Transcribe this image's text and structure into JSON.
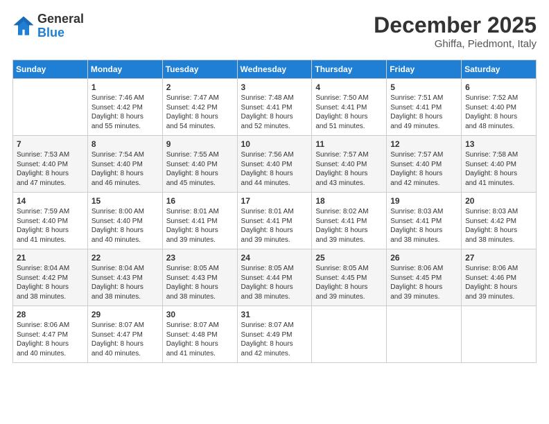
{
  "header": {
    "logo_general": "General",
    "logo_blue": "Blue",
    "month_title": "December 2025",
    "subtitle": "Ghiffa, Piedmont, Italy"
  },
  "weekdays": [
    "Sunday",
    "Monday",
    "Tuesday",
    "Wednesday",
    "Thursday",
    "Friday",
    "Saturday"
  ],
  "weeks": [
    [
      {
        "day": "",
        "text": ""
      },
      {
        "day": "1",
        "text": "Sunrise: 7:46 AM\nSunset: 4:42 PM\nDaylight: 8 hours\nand 55 minutes."
      },
      {
        "day": "2",
        "text": "Sunrise: 7:47 AM\nSunset: 4:42 PM\nDaylight: 8 hours\nand 54 minutes."
      },
      {
        "day": "3",
        "text": "Sunrise: 7:48 AM\nSunset: 4:41 PM\nDaylight: 8 hours\nand 52 minutes."
      },
      {
        "day": "4",
        "text": "Sunrise: 7:50 AM\nSunset: 4:41 PM\nDaylight: 8 hours\nand 51 minutes."
      },
      {
        "day": "5",
        "text": "Sunrise: 7:51 AM\nSunset: 4:41 PM\nDaylight: 8 hours\nand 49 minutes."
      },
      {
        "day": "6",
        "text": "Sunrise: 7:52 AM\nSunset: 4:40 PM\nDaylight: 8 hours\nand 48 minutes."
      }
    ],
    [
      {
        "day": "7",
        "text": "Sunrise: 7:53 AM\nSunset: 4:40 PM\nDaylight: 8 hours\nand 47 minutes."
      },
      {
        "day": "8",
        "text": "Sunrise: 7:54 AM\nSunset: 4:40 PM\nDaylight: 8 hours\nand 46 minutes."
      },
      {
        "day": "9",
        "text": "Sunrise: 7:55 AM\nSunset: 4:40 PM\nDaylight: 8 hours\nand 45 minutes."
      },
      {
        "day": "10",
        "text": "Sunrise: 7:56 AM\nSunset: 4:40 PM\nDaylight: 8 hours\nand 44 minutes."
      },
      {
        "day": "11",
        "text": "Sunrise: 7:57 AM\nSunset: 4:40 PM\nDaylight: 8 hours\nand 43 minutes."
      },
      {
        "day": "12",
        "text": "Sunrise: 7:57 AM\nSunset: 4:40 PM\nDaylight: 8 hours\nand 42 minutes."
      },
      {
        "day": "13",
        "text": "Sunrise: 7:58 AM\nSunset: 4:40 PM\nDaylight: 8 hours\nand 41 minutes."
      }
    ],
    [
      {
        "day": "14",
        "text": "Sunrise: 7:59 AM\nSunset: 4:40 PM\nDaylight: 8 hours\nand 41 minutes."
      },
      {
        "day": "15",
        "text": "Sunrise: 8:00 AM\nSunset: 4:40 PM\nDaylight: 8 hours\nand 40 minutes."
      },
      {
        "day": "16",
        "text": "Sunrise: 8:01 AM\nSunset: 4:41 PM\nDaylight: 8 hours\nand 39 minutes."
      },
      {
        "day": "17",
        "text": "Sunrise: 8:01 AM\nSunset: 4:41 PM\nDaylight: 8 hours\nand 39 minutes."
      },
      {
        "day": "18",
        "text": "Sunrise: 8:02 AM\nSunset: 4:41 PM\nDaylight: 8 hours\nand 39 minutes."
      },
      {
        "day": "19",
        "text": "Sunrise: 8:03 AM\nSunset: 4:41 PM\nDaylight: 8 hours\nand 38 minutes."
      },
      {
        "day": "20",
        "text": "Sunrise: 8:03 AM\nSunset: 4:42 PM\nDaylight: 8 hours\nand 38 minutes."
      }
    ],
    [
      {
        "day": "21",
        "text": "Sunrise: 8:04 AM\nSunset: 4:42 PM\nDaylight: 8 hours\nand 38 minutes."
      },
      {
        "day": "22",
        "text": "Sunrise: 8:04 AM\nSunset: 4:43 PM\nDaylight: 8 hours\nand 38 minutes."
      },
      {
        "day": "23",
        "text": "Sunrise: 8:05 AM\nSunset: 4:43 PM\nDaylight: 8 hours\nand 38 minutes."
      },
      {
        "day": "24",
        "text": "Sunrise: 8:05 AM\nSunset: 4:44 PM\nDaylight: 8 hours\nand 38 minutes."
      },
      {
        "day": "25",
        "text": "Sunrise: 8:05 AM\nSunset: 4:45 PM\nDaylight: 8 hours\nand 39 minutes."
      },
      {
        "day": "26",
        "text": "Sunrise: 8:06 AM\nSunset: 4:45 PM\nDaylight: 8 hours\nand 39 minutes."
      },
      {
        "day": "27",
        "text": "Sunrise: 8:06 AM\nSunset: 4:46 PM\nDaylight: 8 hours\nand 39 minutes."
      }
    ],
    [
      {
        "day": "28",
        "text": "Sunrise: 8:06 AM\nSunset: 4:47 PM\nDaylight: 8 hours\nand 40 minutes."
      },
      {
        "day": "29",
        "text": "Sunrise: 8:07 AM\nSunset: 4:47 PM\nDaylight: 8 hours\nand 40 minutes."
      },
      {
        "day": "30",
        "text": "Sunrise: 8:07 AM\nSunset: 4:48 PM\nDaylight: 8 hours\nand 41 minutes."
      },
      {
        "day": "31",
        "text": "Sunrise: 8:07 AM\nSunset: 4:49 PM\nDaylight: 8 hours\nand 42 minutes."
      },
      {
        "day": "",
        "text": ""
      },
      {
        "day": "",
        "text": ""
      },
      {
        "day": "",
        "text": ""
      }
    ]
  ]
}
